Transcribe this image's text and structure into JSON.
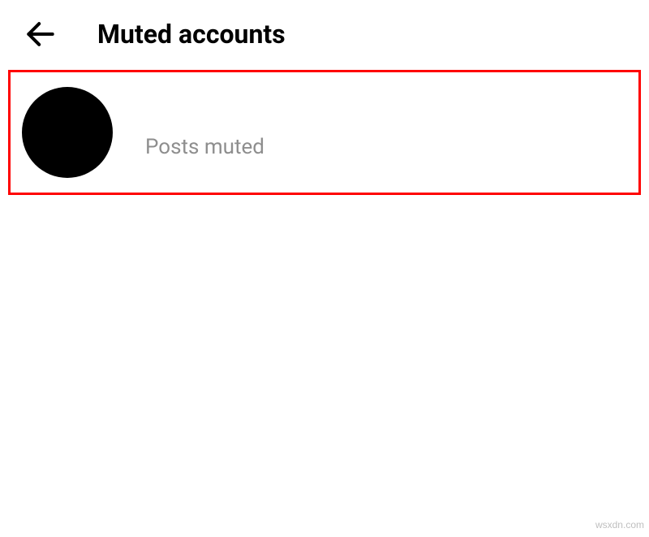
{
  "header": {
    "title": "Muted accounts"
  },
  "accounts": [
    {
      "status": "Posts muted"
    }
  ],
  "watermark": "wsxdn.com"
}
